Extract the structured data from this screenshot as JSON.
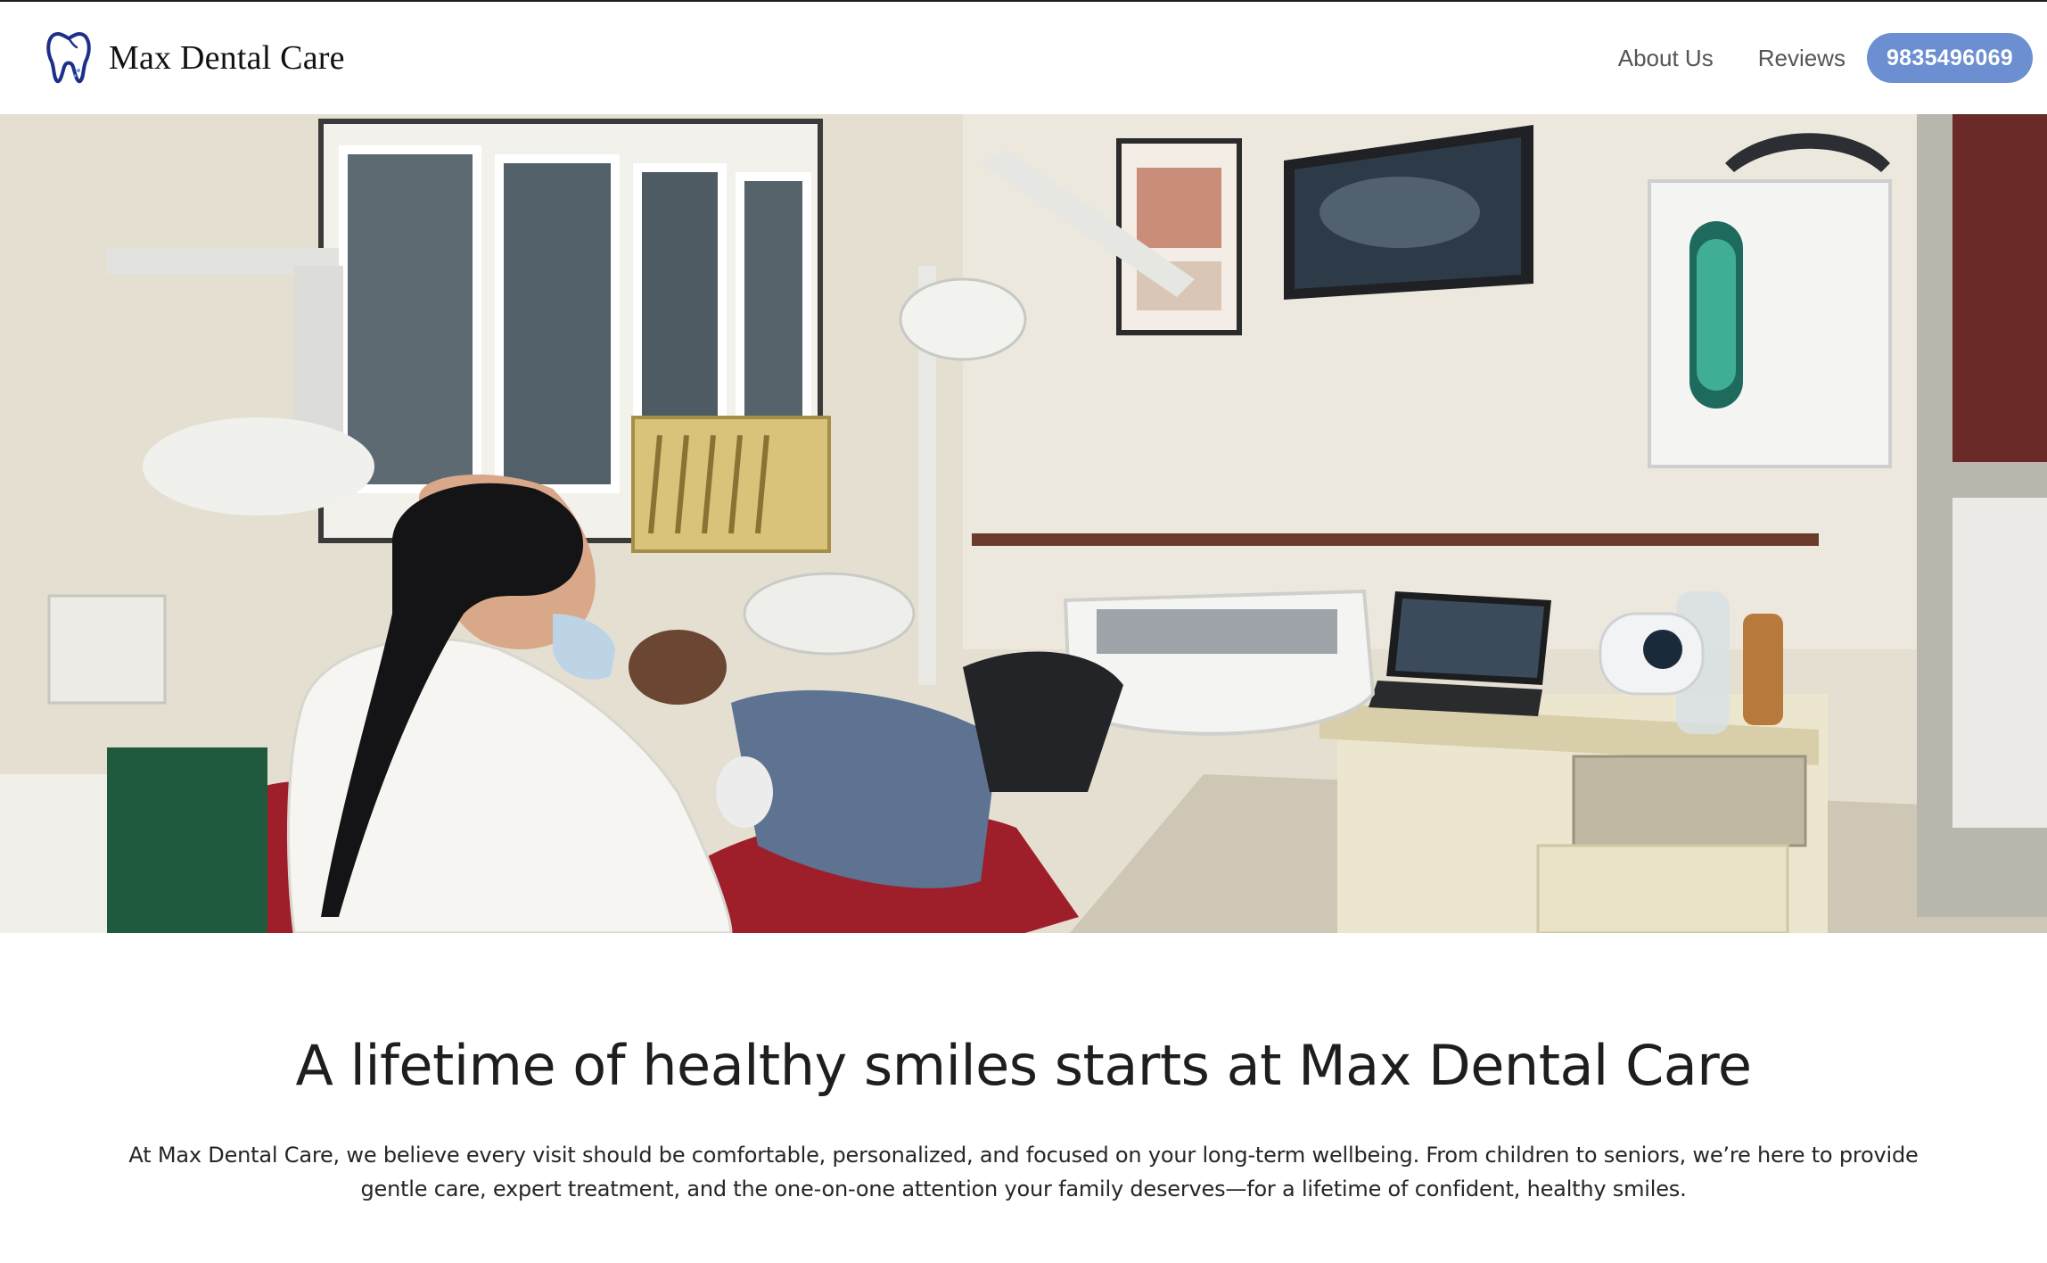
{
  "brand": {
    "name": "Max Dental Care",
    "logo_icon": "tooth-icon"
  },
  "nav": {
    "links": [
      {
        "label": "About Us"
      },
      {
        "label": "Reviews"
      }
    ],
    "phone": "9835496069"
  },
  "hero": {
    "image": "dental-clinic-photo"
  },
  "main": {
    "headline": "A lifetime of healthy smiles starts at Max Dental Care",
    "intro": "At Max Dental Care, we believe every visit should be comfortable, personalized, and focused on your long-term wellbeing. From children to seniors, we’re here to provide gentle care, expert treatment, and the one-on-one attention your family deserves—for a lifetime of confident, healthy smiles."
  },
  "colors": {
    "accent": "#6b8fd1",
    "logo_blue": "#1e2f8a",
    "text": "#1e1e1e"
  }
}
